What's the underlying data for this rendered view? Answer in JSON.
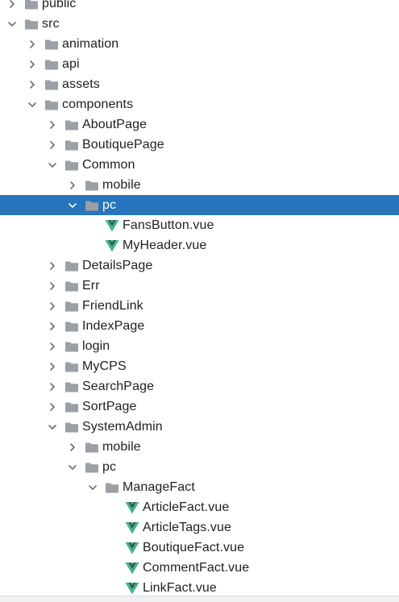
{
  "colors": {
    "selection": "#2675bf",
    "folder": "#9aa0a6",
    "vue_green": "#41b883",
    "vue_dark": "#35495e",
    "text": "#1f1f1f"
  },
  "tree": [
    {
      "label": "public",
      "type": "folder",
      "depth": 0,
      "state": "collapsed",
      "selected": false
    },
    {
      "label": "src",
      "type": "folder",
      "depth": 0,
      "state": "expanded",
      "selected": false
    },
    {
      "label": "animation",
      "type": "folder",
      "depth": 1,
      "state": "collapsed",
      "selected": false
    },
    {
      "label": "api",
      "type": "folder",
      "depth": 1,
      "state": "collapsed",
      "selected": false
    },
    {
      "label": "assets",
      "type": "folder",
      "depth": 1,
      "state": "collapsed",
      "selected": false
    },
    {
      "label": "components",
      "type": "folder",
      "depth": 1,
      "state": "expanded",
      "selected": false
    },
    {
      "label": "AboutPage",
      "type": "folder",
      "depth": 2,
      "state": "collapsed",
      "selected": false
    },
    {
      "label": "BoutiquePage",
      "type": "folder",
      "depth": 2,
      "state": "collapsed",
      "selected": false
    },
    {
      "label": "Common",
      "type": "folder",
      "depth": 2,
      "state": "expanded",
      "selected": false
    },
    {
      "label": "mobile",
      "type": "folder",
      "depth": 3,
      "state": "collapsed",
      "selected": false
    },
    {
      "label": "pc",
      "type": "folder",
      "depth": 3,
      "state": "expanded",
      "selected": true
    },
    {
      "label": "FansButton.vue",
      "type": "vue",
      "depth": 4,
      "state": "none",
      "selected": false
    },
    {
      "label": "MyHeader.vue",
      "type": "vue",
      "depth": 4,
      "state": "none",
      "selected": false
    },
    {
      "label": "DetailsPage",
      "type": "folder",
      "depth": 2,
      "state": "collapsed",
      "selected": false
    },
    {
      "label": "Err",
      "type": "folder",
      "depth": 2,
      "state": "collapsed",
      "selected": false
    },
    {
      "label": "FriendLink",
      "type": "folder",
      "depth": 2,
      "state": "collapsed",
      "selected": false
    },
    {
      "label": "IndexPage",
      "type": "folder",
      "depth": 2,
      "state": "collapsed",
      "selected": false
    },
    {
      "label": "login",
      "type": "folder",
      "depth": 2,
      "state": "collapsed",
      "selected": false
    },
    {
      "label": "MyCPS",
      "type": "folder",
      "depth": 2,
      "state": "collapsed",
      "selected": false
    },
    {
      "label": "SearchPage",
      "type": "folder",
      "depth": 2,
      "state": "collapsed",
      "selected": false
    },
    {
      "label": "SortPage",
      "type": "folder",
      "depth": 2,
      "state": "collapsed",
      "selected": false
    },
    {
      "label": "SystemAdmin",
      "type": "folder",
      "depth": 2,
      "state": "expanded",
      "selected": false
    },
    {
      "label": "mobile",
      "type": "folder",
      "depth": 3,
      "state": "collapsed",
      "selected": false
    },
    {
      "label": "pc",
      "type": "folder",
      "depth": 3,
      "state": "expanded",
      "selected": false
    },
    {
      "label": "ManageFact",
      "type": "folder",
      "depth": 4,
      "state": "expanded",
      "selected": false
    },
    {
      "label": "ArticleFact.vue",
      "type": "vue",
      "depth": 5,
      "state": "none",
      "selected": false
    },
    {
      "label": "ArticleTags.vue",
      "type": "vue",
      "depth": 5,
      "state": "none",
      "selected": false
    },
    {
      "label": "BoutiqueFact.vue",
      "type": "vue",
      "depth": 5,
      "state": "none",
      "selected": false
    },
    {
      "label": "CommentFact.vue",
      "type": "vue",
      "depth": 5,
      "state": "none",
      "selected": false
    },
    {
      "label": "LinkFact.vue",
      "type": "vue",
      "depth": 5,
      "state": "none",
      "selected": false
    }
  ]
}
